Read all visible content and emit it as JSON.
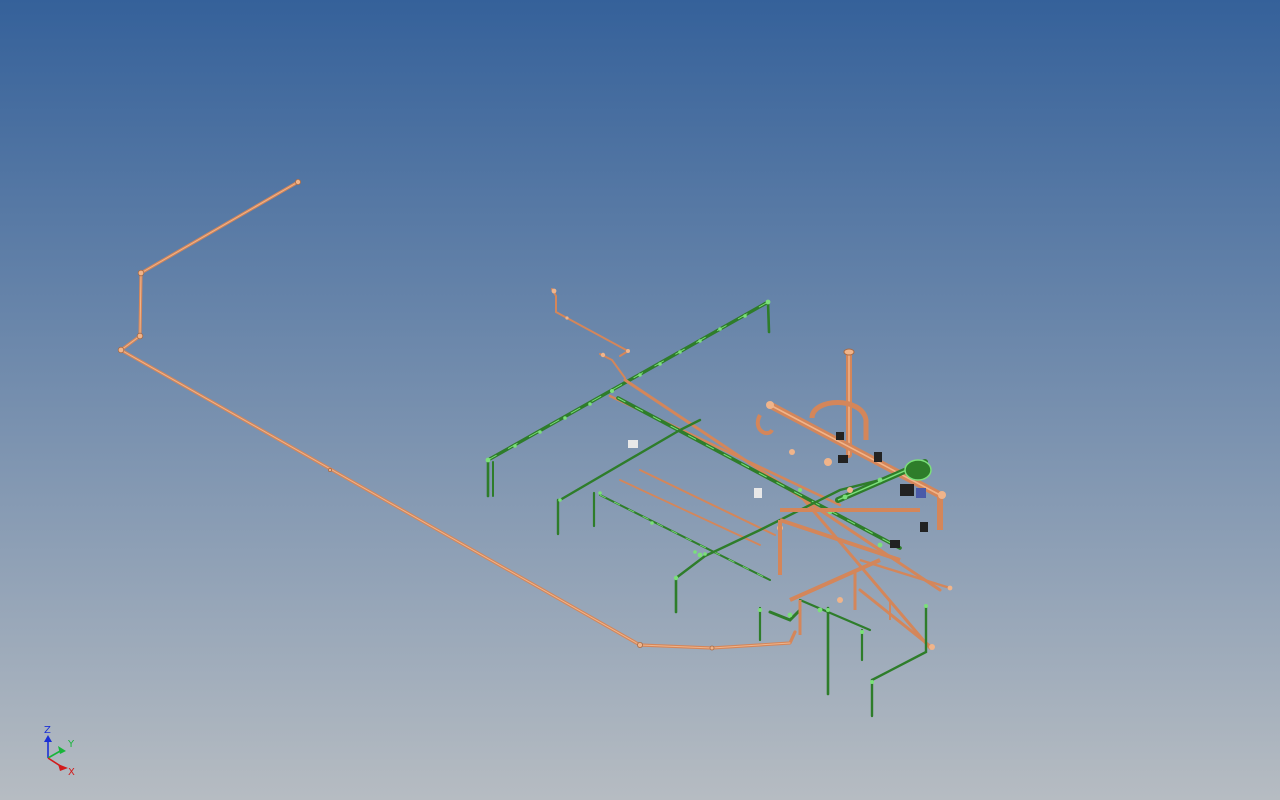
{
  "viewport": {
    "background_top": "#35619a",
    "background_bottom": "#b6bcc2"
  },
  "colors": {
    "copper_pipe": "#d4865a",
    "copper_highlight": "#f0b48a",
    "green_pipe": "#2e7d2a",
    "green_highlight": "#7be07a",
    "fitting": "#8a6a50",
    "valve_dark": "#222222",
    "valve_blue": "#4a5aa8",
    "white_fitting": "#e8e8e8"
  },
  "axis_triad": {
    "z_label": "Z",
    "y_label": "Y",
    "x_label": "X",
    "z_color": "#1a2fd6",
    "y_color": "#18b53a",
    "x_color": "#d21a1a"
  }
}
